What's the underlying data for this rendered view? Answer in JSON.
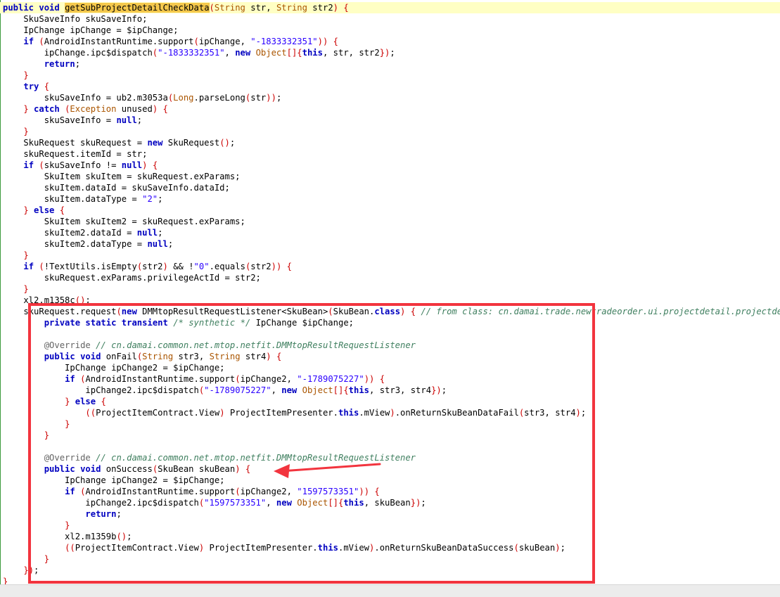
{
  "editor": {
    "lines": [
      [
        [
          "k",
          "public"
        ],
        [
          "p",
          " "
        ],
        [
          "k",
          "void"
        ],
        [
          "p",
          " "
        ],
        [
          "h",
          "getSubProjectDetailCheckData"
        ],
        [
          "u",
          "("
        ],
        [
          "t",
          "String"
        ],
        [
          "p",
          " str, "
        ],
        [
          "t",
          "String"
        ],
        [
          "p",
          " str2"
        ],
        [
          "u",
          ")"
        ],
        [
          "p",
          " "
        ],
        [
          "u",
          "{"
        ]
      ],
      [
        [
          "p",
          "    SkuSaveInfo skuSaveInfo;"
        ]
      ],
      [
        [
          "p",
          "    IpChange ipChange = $ipChange;"
        ]
      ],
      [
        [
          "p",
          "    "
        ],
        [
          "k",
          "if"
        ],
        [
          "p",
          " "
        ],
        [
          "u",
          "("
        ],
        [
          "p",
          "AndroidInstantRuntime.support"
        ],
        [
          "u",
          "("
        ],
        [
          "p",
          "ipChange, "
        ],
        [
          "s",
          "\"-1833332351\""
        ],
        [
          "u",
          "))"
        ],
        [
          "p",
          " "
        ],
        [
          "u",
          "{"
        ]
      ],
      [
        [
          "p",
          "        ipChange.ipc$dispatch"
        ],
        [
          "u",
          "("
        ],
        [
          "s",
          "\"-1833332351\""
        ],
        [
          "p",
          ", "
        ],
        [
          "k",
          "new"
        ],
        [
          "p",
          " "
        ],
        [
          "t",
          "Object"
        ],
        [
          "u",
          "[]{"
        ],
        [
          "k",
          "this"
        ],
        [
          "p",
          ", str, str2"
        ],
        [
          "u",
          "})"
        ],
        [
          "p",
          ";"
        ]
      ],
      [
        [
          "p",
          "        "
        ],
        [
          "k",
          "return"
        ],
        [
          "p",
          ";"
        ]
      ],
      [
        [
          "p",
          "    "
        ],
        [
          "u",
          "}"
        ]
      ],
      [
        [
          "p",
          "    "
        ],
        [
          "k",
          "try"
        ],
        [
          "p",
          " "
        ],
        [
          "u",
          "{"
        ]
      ],
      [
        [
          "p",
          "        skuSaveInfo = ub2.m3053a"
        ],
        [
          "u",
          "("
        ],
        [
          "t",
          "Long"
        ],
        [
          "p",
          ".parseLong"
        ],
        [
          "u",
          "("
        ],
        [
          "p",
          "str"
        ],
        [
          "u",
          "))"
        ],
        [
          "p",
          ";"
        ]
      ],
      [
        [
          "p",
          "    "
        ],
        [
          "u",
          "}"
        ],
        [
          "p",
          " "
        ],
        [
          "k",
          "catch"
        ],
        [
          "p",
          " "
        ],
        [
          "u",
          "("
        ],
        [
          "t",
          "Exception"
        ],
        [
          "p",
          " unused"
        ],
        [
          "u",
          ")"
        ],
        [
          "p",
          " "
        ],
        [
          "u",
          "{"
        ]
      ],
      [
        [
          "p",
          "        skuSaveInfo = "
        ],
        [
          "k",
          "null"
        ],
        [
          "p",
          ";"
        ]
      ],
      [
        [
          "p",
          "    "
        ],
        [
          "u",
          "}"
        ]
      ],
      [
        [
          "p",
          "    SkuRequest skuRequest = "
        ],
        [
          "k",
          "new"
        ],
        [
          "p",
          " SkuRequest"
        ],
        [
          "u",
          "()"
        ],
        [
          "p",
          ";"
        ]
      ],
      [
        [
          "p",
          "    skuRequest.itemId = str;"
        ]
      ],
      [
        [
          "p",
          "    "
        ],
        [
          "k",
          "if"
        ],
        [
          "p",
          " "
        ],
        [
          "u",
          "("
        ],
        [
          "p",
          "skuSaveInfo != "
        ],
        [
          "k",
          "null"
        ],
        [
          "u",
          ")"
        ],
        [
          "p",
          " "
        ],
        [
          "u",
          "{"
        ]
      ],
      [
        [
          "p",
          "        SkuItem skuItem = skuRequest.exParams;"
        ]
      ],
      [
        [
          "p",
          "        skuItem.dataId = skuSaveInfo.dataId;"
        ]
      ],
      [
        [
          "p",
          "        skuItem.dataType = "
        ],
        [
          "s",
          "\"2\""
        ],
        [
          "p",
          ";"
        ]
      ],
      [
        [
          "p",
          "    "
        ],
        [
          "u",
          "}"
        ],
        [
          "p",
          " "
        ],
        [
          "k",
          "else"
        ],
        [
          "p",
          " "
        ],
        [
          "u",
          "{"
        ]
      ],
      [
        [
          "p",
          "        SkuItem skuItem2 = skuRequest.exParams;"
        ]
      ],
      [
        [
          "p",
          "        skuItem2.dataId = "
        ],
        [
          "k",
          "null"
        ],
        [
          "p",
          ";"
        ]
      ],
      [
        [
          "p",
          "        skuItem2.dataType = "
        ],
        [
          "k",
          "null"
        ],
        [
          "p",
          ";"
        ]
      ],
      [
        [
          "p",
          "    "
        ],
        [
          "u",
          "}"
        ]
      ],
      [
        [
          "p",
          "    "
        ],
        [
          "k",
          "if"
        ],
        [
          "p",
          " "
        ],
        [
          "u",
          "("
        ],
        [
          "p",
          "!TextUtils.isEmpty"
        ],
        [
          "u",
          "("
        ],
        [
          "p",
          "str2"
        ],
        [
          "u",
          ")"
        ],
        [
          "p",
          " && !"
        ],
        [
          "s",
          "\"0\""
        ],
        [
          "p",
          ".equals"
        ],
        [
          "u",
          "("
        ],
        [
          "p",
          "str2"
        ],
        [
          "u",
          "))"
        ],
        [
          "p",
          " "
        ],
        [
          "u",
          "{"
        ]
      ],
      [
        [
          "p",
          "        skuRequest.exParams.privilegeActId = str2;"
        ]
      ],
      [
        [
          "p",
          "    "
        ],
        [
          "u",
          "}"
        ]
      ],
      [
        [
          "p",
          "    xl2.m1358c"
        ],
        [
          "u",
          "()"
        ],
        [
          "p",
          ";"
        ]
      ],
      [
        [
          "p",
          "    skuRequest.request"
        ],
        [
          "u",
          "("
        ],
        [
          "k",
          "new"
        ],
        [
          "p",
          " DMMtopResultRequestListener<SkuBean>"
        ],
        [
          "u",
          "("
        ],
        [
          "p",
          "SkuBean."
        ],
        [
          "k",
          "class"
        ],
        [
          "u",
          ")"
        ],
        [
          "p",
          " "
        ],
        [
          "u",
          "{"
        ],
        [
          "p",
          " "
        ],
        [
          "c",
          "// from class: cn.damai.trade.newtradeorder.ui.projectdetail.projectdetail.presenter.ProjectItemPresenter"
        ]
      ],
      [
        [
          "p",
          "        "
        ],
        [
          "k",
          "private"
        ],
        [
          "p",
          " "
        ],
        [
          "k",
          "static"
        ],
        [
          "p",
          " "
        ],
        [
          "k",
          "transient"
        ],
        [
          "p",
          " "
        ],
        [
          "c",
          "/* synthetic */"
        ],
        [
          "p",
          " IpChange $ipChange;"
        ]
      ],
      [
        [
          "p",
          ""
        ]
      ],
      [
        [
          "p",
          "        "
        ],
        [
          "a",
          "@Override"
        ],
        [
          "p",
          " "
        ],
        [
          "c",
          "// cn.damai.common.net.mtop.netfit.DMMtopResultRequestListener"
        ]
      ],
      [
        [
          "p",
          "        "
        ],
        [
          "k",
          "public"
        ],
        [
          "p",
          " "
        ],
        [
          "k",
          "void"
        ],
        [
          "p",
          " onFail"
        ],
        [
          "u",
          "("
        ],
        [
          "t",
          "String"
        ],
        [
          "p",
          " str3, "
        ],
        [
          "t",
          "String"
        ],
        [
          "p",
          " str4"
        ],
        [
          "u",
          ")"
        ],
        [
          "p",
          " "
        ],
        [
          "u",
          "{"
        ]
      ],
      [
        [
          "p",
          "            IpChange ipChange2 = $ipChange;"
        ]
      ],
      [
        [
          "p",
          "            "
        ],
        [
          "k",
          "if"
        ],
        [
          "p",
          " "
        ],
        [
          "u",
          "("
        ],
        [
          "p",
          "AndroidInstantRuntime.support"
        ],
        [
          "u",
          "("
        ],
        [
          "p",
          "ipChange2, "
        ],
        [
          "s",
          "\"-1789075227\""
        ],
        [
          "u",
          "))"
        ],
        [
          "p",
          " "
        ],
        [
          "u",
          "{"
        ]
      ],
      [
        [
          "p",
          "                ipChange2.ipc$dispatch"
        ],
        [
          "u",
          "("
        ],
        [
          "s",
          "\"-1789075227\""
        ],
        [
          "p",
          ", "
        ],
        [
          "k",
          "new"
        ],
        [
          "p",
          " "
        ],
        [
          "t",
          "Object"
        ],
        [
          "u",
          "[]{"
        ],
        [
          "k",
          "this"
        ],
        [
          "p",
          ", str3, str4"
        ],
        [
          "u",
          "})"
        ],
        [
          "p",
          ";"
        ]
      ],
      [
        [
          "p",
          "            "
        ],
        [
          "u",
          "}"
        ],
        [
          "p",
          " "
        ],
        [
          "k",
          "else"
        ],
        [
          "p",
          " "
        ],
        [
          "u",
          "{"
        ]
      ],
      [
        [
          "p",
          "                "
        ],
        [
          "u",
          "(("
        ],
        [
          "p",
          "ProjectItemContract.View"
        ],
        [
          "u",
          ")"
        ],
        [
          "p",
          " ProjectItemPresenter."
        ],
        [
          "k",
          "this"
        ],
        [
          "p",
          ".mView"
        ],
        [
          "u",
          ")"
        ],
        [
          "p",
          ".onReturnSkuBeanDataFail"
        ],
        [
          "u",
          "("
        ],
        [
          "p",
          "str3, str4"
        ],
        [
          "u",
          ")"
        ],
        [
          "p",
          ";"
        ]
      ],
      [
        [
          "p",
          "            "
        ],
        [
          "u",
          "}"
        ]
      ],
      [
        [
          "p",
          "        "
        ],
        [
          "u",
          "}"
        ]
      ],
      [
        [
          "p",
          ""
        ]
      ],
      [
        [
          "p",
          "        "
        ],
        [
          "a",
          "@Override"
        ],
        [
          "p",
          " "
        ],
        [
          "c",
          "// cn.damai.common.net.mtop.netfit.DMMtopResultRequestListener"
        ]
      ],
      [
        [
          "p",
          "        "
        ],
        [
          "k",
          "public"
        ],
        [
          "p",
          " "
        ],
        [
          "k",
          "void"
        ],
        [
          "p",
          " onSuccess"
        ],
        [
          "u",
          "("
        ],
        [
          "p",
          "SkuBean skuBean"
        ],
        [
          "u",
          ")"
        ],
        [
          "p",
          " "
        ],
        [
          "u",
          "{"
        ]
      ],
      [
        [
          "p",
          "            IpChange ipChange2 = $ipChange;"
        ]
      ],
      [
        [
          "p",
          "            "
        ],
        [
          "k",
          "if"
        ],
        [
          "p",
          " "
        ],
        [
          "u",
          "("
        ],
        [
          "p",
          "AndroidInstantRuntime.support"
        ],
        [
          "u",
          "("
        ],
        [
          "p",
          "ipChange2, "
        ],
        [
          "s",
          "\"1597573351\""
        ],
        [
          "u",
          "))"
        ],
        [
          "p",
          " "
        ],
        [
          "u",
          "{"
        ]
      ],
      [
        [
          "p",
          "                ipChange2.ipc$dispatch"
        ],
        [
          "u",
          "("
        ],
        [
          "s",
          "\"1597573351\""
        ],
        [
          "p",
          ", "
        ],
        [
          "k",
          "new"
        ],
        [
          "p",
          " "
        ],
        [
          "t",
          "Object"
        ],
        [
          "u",
          "[]{"
        ],
        [
          "k",
          "this"
        ],
        [
          "p",
          ", skuBean"
        ],
        [
          "u",
          "})"
        ],
        [
          "p",
          ";"
        ]
      ],
      [
        [
          "p",
          "                "
        ],
        [
          "k",
          "return"
        ],
        [
          "p",
          ";"
        ]
      ],
      [
        [
          "p",
          "            "
        ],
        [
          "u",
          "}"
        ]
      ],
      [
        [
          "p",
          "            xl2.m1359b"
        ],
        [
          "u",
          "()"
        ],
        [
          "p",
          ";"
        ]
      ],
      [
        [
          "p",
          "            "
        ],
        [
          "u",
          "(("
        ],
        [
          "p",
          "ProjectItemContract.View"
        ],
        [
          "u",
          ")"
        ],
        [
          "p",
          " ProjectItemPresenter."
        ],
        [
          "k",
          "this"
        ],
        [
          "p",
          ".mView"
        ],
        [
          "u",
          ")"
        ],
        [
          "p",
          ".onReturnSkuBeanDataSuccess"
        ],
        [
          "u",
          "("
        ],
        [
          "p",
          "skuBean"
        ],
        [
          "u",
          ")"
        ],
        [
          "p",
          ";"
        ]
      ],
      [
        [
          "p",
          "        "
        ],
        [
          "u",
          "}"
        ]
      ],
      [
        [
          "p",
          "    "
        ],
        [
          "u",
          "})"
        ],
        [
          "p",
          ";"
        ]
      ],
      [
        [
          "u",
          "}"
        ]
      ]
    ]
  },
  "annotations": {
    "box_color": "#f2343e",
    "arrow_color": "#f2343e"
  }
}
